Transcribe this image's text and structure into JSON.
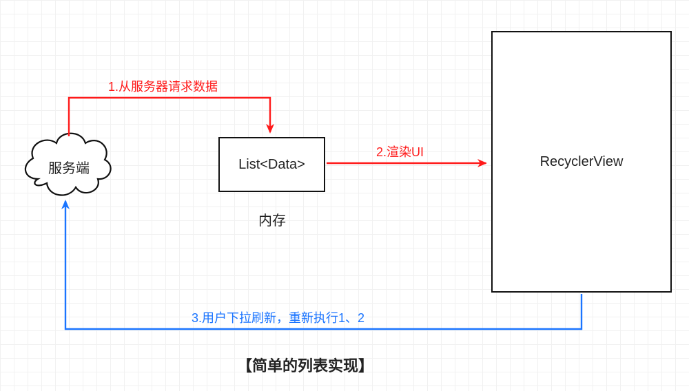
{
  "nodes": {
    "server": {
      "label": "服务端"
    },
    "list": {
      "label": "List<Data>"
    },
    "memory": {
      "label": "内存"
    },
    "recycler": {
      "label": "RecyclerView"
    }
  },
  "flows": {
    "f1": {
      "label": "1.从服务器请求数据",
      "color": "#ff1a1a"
    },
    "f2": {
      "label": "2.渲染UI",
      "color": "#ff1a1a"
    },
    "f3": {
      "label": "3.用户下拉刷新，重新执行1、2",
      "color": "#1a74ff"
    }
  },
  "title": "【简单的列表实现】",
  "colors": {
    "red": "#ff1a1a",
    "blue": "#1a74ff",
    "stroke": "#111111"
  }
}
